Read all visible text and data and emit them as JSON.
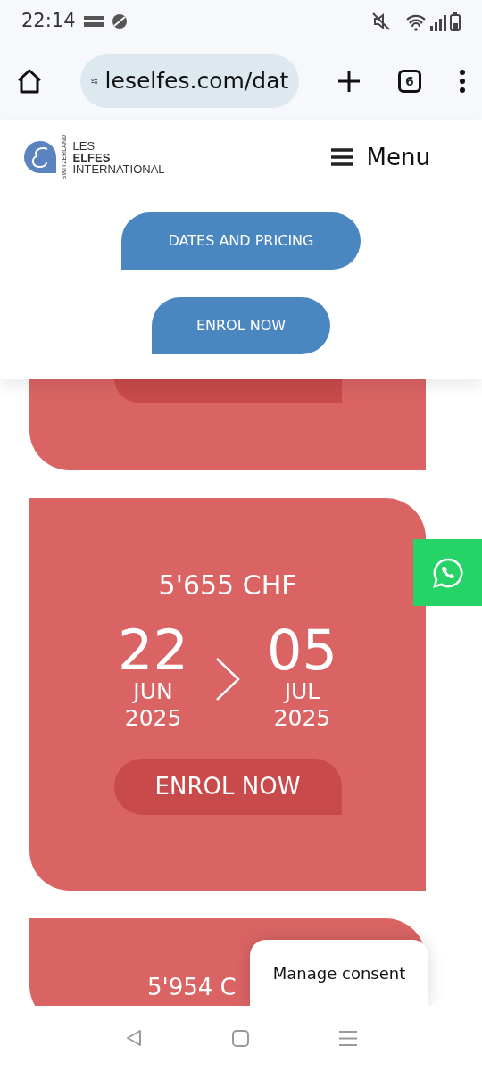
{
  "status_bar": {
    "time": "22:14"
  },
  "browser": {
    "url": "leselfes.com/dat",
    "tab_count": "6"
  },
  "site_header": {
    "logo": {
      "tagline": "SWITZERLAND",
      "line_1": "LES",
      "line_2": "ELFES",
      "line_3": "INTERNATIONAL"
    },
    "menu_label": "Menu",
    "buttons": [
      "DATES AND PRICING",
      "ENROL NOW"
    ]
  },
  "cards": [
    {
      "kind": "tail"
    },
    {
      "kind": "full",
      "price": "5'655 CHF",
      "start": {
        "day": "22",
        "month": "JUN",
        "year": "2025"
      },
      "end": {
        "day": "05",
        "month": "JUL",
        "year": "2025"
      },
      "button": "ENROL NOW"
    },
    {
      "kind": "head",
      "price": "5'954 C"
    }
  ],
  "consent": {
    "label": "Manage consent"
  }
}
